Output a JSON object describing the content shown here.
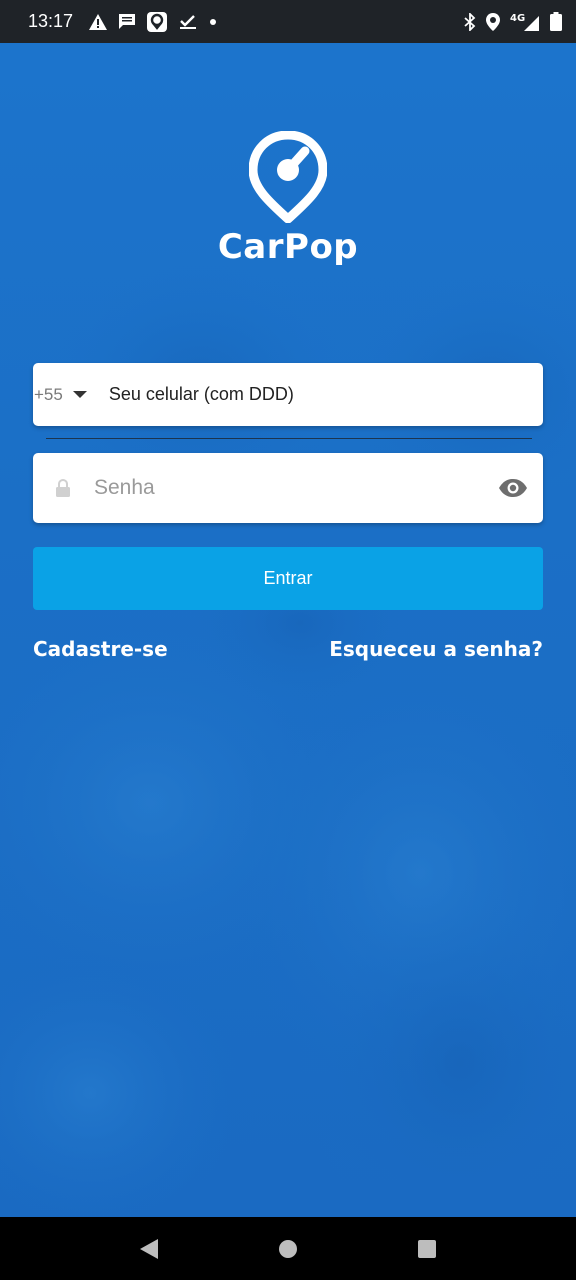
{
  "status_bar": {
    "time": "13:17",
    "left_icons": [
      "warning-icon",
      "message-icon",
      "location-app-icon",
      "check-icon",
      "dot-icon"
    ],
    "network": "4G",
    "right_icons": [
      "bluetooth-icon",
      "location-pin-icon",
      "signal-icon",
      "battery-icon"
    ]
  },
  "logo": {
    "brand_name": "CarPop",
    "icon": "carpop-pin-logo-icon"
  },
  "login_form": {
    "country_code": "+55",
    "phone_placeholder": "Seu celular (com DDD)",
    "password_placeholder": "Senha",
    "submit_label": "Entrar"
  },
  "links": {
    "signup_label": "Cadastre-se",
    "forgot_label": "Esqueceu a senha?"
  },
  "nav_bar": {
    "buttons": [
      "back-icon",
      "home-icon",
      "recents-icon"
    ]
  },
  "colors": {
    "background": "#1a6fc4",
    "button": "#0aa2e6",
    "status_bar": "#1f2328",
    "nav_bar": "#000000"
  }
}
